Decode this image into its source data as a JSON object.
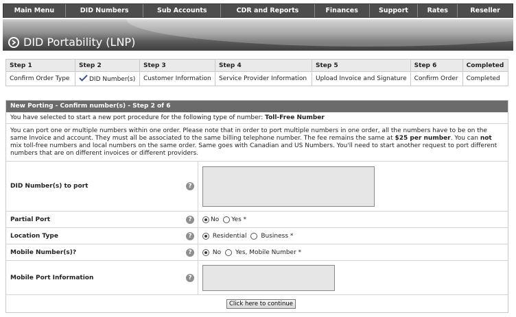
{
  "nav": {
    "items": [
      {
        "label": "Main Menu"
      },
      {
        "label": "DID Numbers"
      },
      {
        "label": "Sub Accounts"
      },
      {
        "label": "CDR and Reports"
      },
      {
        "label": "Finances"
      },
      {
        "label": "Support"
      },
      {
        "label": "Rates"
      },
      {
        "label": "Reseller"
      }
    ]
  },
  "page": {
    "title": "DID Portability (LNP)",
    "title_icon": "circle-arrow-icon"
  },
  "steps": {
    "headers": [
      "Step 1",
      "Step 2",
      "Step 3",
      "Step 4",
      "Step 5",
      "Step 6",
      "Completed"
    ],
    "labels": [
      "Confirm Order Type",
      "DID Number(s)",
      "Customer Information",
      "Service Provider Information",
      "Upload Invoice and Signature",
      "Confirm Order",
      "Completed"
    ],
    "current_icon": "check-icon"
  },
  "form": {
    "header": "New Porting - Confirm number(s) - Step 2 of 6",
    "intro_prefix": "You have selected to start a new port procedure for the following type of number:",
    "intro_type": "Toll-Free Number",
    "notice_1": "You can port one or multiple numbers within one order. Please note that in order to port multiple numbers in one order, all the numbers have to be on the same Invoice and account. They must all be associated to the same billing telephone number. The fee remains the same at",
    "notice_fee": "$25 per number",
    "notice_2": ". You can",
    "notice_not": "not",
    "notice_3": "mix toll-free numbers and local numbers on the same order. Same goes with Canadian and US Numbers. You'll need to start another request to port different numbers that are on different invoices or different providers.",
    "did_label": "DID Number(s) to port",
    "did_value": "",
    "partial_label": "Partial Port",
    "partial_options": [
      "No",
      "Yes *"
    ],
    "partial_selected": "No",
    "location_label": "Location Type",
    "location_options": [
      "Residential",
      "Business *"
    ],
    "location_selected": "Residential",
    "mobile_label": "Mobile Number(s)?",
    "mobile_options": [
      "No",
      "Yes, Mobile Number *"
    ],
    "mobile_selected": "No",
    "mobile_info_label": "Mobile Port Information",
    "mobile_info_value": "",
    "help_glyph": "?",
    "continue_label": "Click here to continue"
  }
}
